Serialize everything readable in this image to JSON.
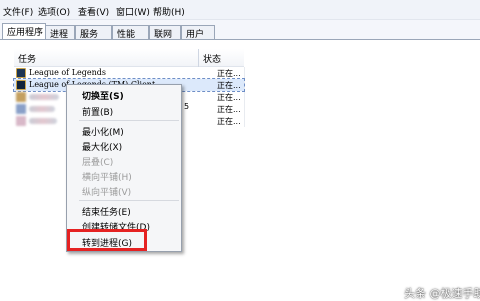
{
  "menubar": {
    "file": "文件(F)",
    "options": "选项(O)",
    "view": "查看(V)",
    "windows": "窗口(W)",
    "help": "帮助(H)"
  },
  "tabs": [
    "应用程序",
    "进程",
    "服务",
    "性能",
    "联网",
    "用户"
  ],
  "columns": {
    "task": "任务",
    "status": "状态"
  },
  "rows": [
    {
      "name": "League of Legends",
      "status": "正在..."
    },
    {
      "name": "League of Legends (TM) Client",
      "status": "正在..."
    },
    {
      "name": "",
      "status": "正在..."
    },
    {
      "name": "",
      "status": "正在..."
    },
    {
      "name": "",
      "status": "正在..."
    }
  ],
  "row_suffix": "5",
  "context_menu": {
    "switch_to": "切换至(S)",
    "bring_to_front": "前置(B)",
    "minimize": "最小化(M)",
    "maximize": "最大化(X)",
    "cascade": "层叠(C)",
    "tile_horizontal": "横向平铺(H)",
    "tile_vertical": "纵向平铺(V)",
    "end_task": "结束任务(E)",
    "create_dump": "创建转储文件(D)",
    "go_to_process": "转到进程(G)"
  },
  "watermark": "头条 @极速手助",
  "colors": {
    "highlight_box": "#e52222",
    "selected_row": "#dce9fb"
  }
}
